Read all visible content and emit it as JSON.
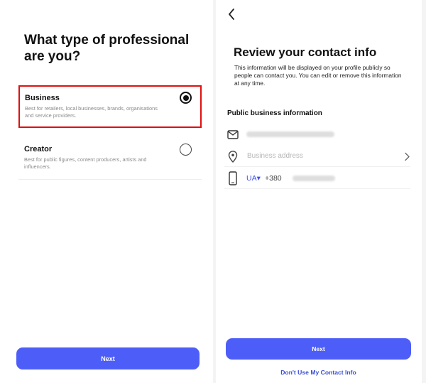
{
  "left_screen": {
    "title": "What type of professional are you?",
    "options": [
      {
        "title": "Business",
        "description": "Best for retailers, local businesses, brands, organisations and service providers.",
        "selected": true
      },
      {
        "title": "Creator",
        "description": "Best for public figures, content producers, artists and influencers.",
        "selected": false
      }
    ],
    "next_label": "Next"
  },
  "right_screen": {
    "title": "Review your contact info",
    "description": "This information will be displayed on your profile publicly so people can contact you. You can edit or remove this information at any time.",
    "section_label": "Public business information",
    "fields": {
      "address_placeholder": "Business address",
      "country_code": "UA▾",
      "dial_code": "+380"
    },
    "next_label": "Next",
    "dont_use_label": "Don't Use My Contact Info"
  },
  "colors": {
    "accent": "#4d5ef8",
    "link": "#3b4fd4",
    "highlight": "#e01010"
  },
  "icons": [
    "chevron-left-icon",
    "mail-icon",
    "location-pin-icon",
    "chevron-right-icon",
    "phone-icon"
  ]
}
